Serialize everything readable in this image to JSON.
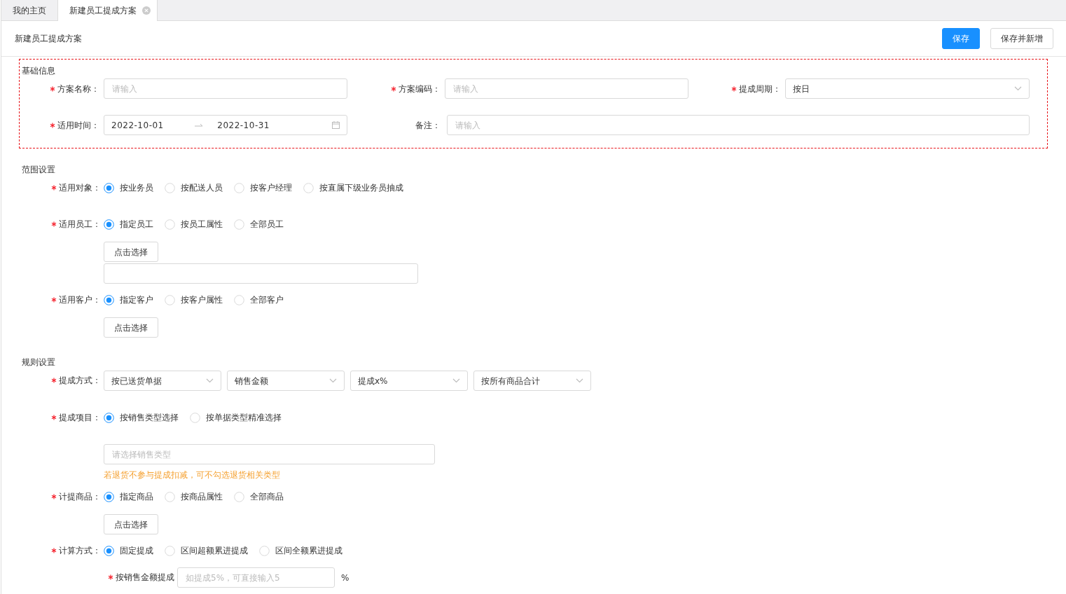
{
  "tabs": [
    {
      "label": "我的主页",
      "selected": false,
      "closable": false
    },
    {
      "label": "新建员工提成方案",
      "selected": true,
      "closable": true
    }
  ],
  "page_title": "新建员工提成方案",
  "buttons": [
    {
      "label": "保存",
      "kind": "primary"
    },
    {
      "label": "保存并新增",
      "kind": "default"
    }
  ],
  "basic_info": {
    "title": "基础信息",
    "highlighted": true,
    "rows": [
      [
        {
          "kind": "input",
          "label": "方案名称：",
          "required": true,
          "placeholder": "请输入"
        },
        {
          "kind": "input",
          "label": "方案编码：",
          "required": true,
          "placeholder": "请输入"
        },
        {
          "kind": "select",
          "label": "提成周期：",
          "required": true,
          "value": "按日"
        }
      ],
      [
        {
          "kind": "daterange",
          "label": "适用时间：",
          "required": true,
          "start": "2022-10-01",
          "end": "2022-10-31"
        },
        {
          "kind": "input",
          "label": "备注：",
          "required": false,
          "placeholder": "请输入"
        }
      ]
    ]
  },
  "sections": [
    {
      "title": "范围设置",
      "items": [
        {
          "label": "适用对象：",
          "required": true,
          "controls": [
            {
              "kind": "radio",
              "options": [
                {
                  "label": "按业务员",
                  "selected": true
                },
                {
                  "label": "按配送人员",
                  "selected": false
                },
                {
                  "label": "按客户经理",
                  "selected": false
                },
                {
                  "label": "按直属下级业务员抽成",
                  "selected": false
                }
              ]
            }
          ]
        },
        {
          "label": "适用员工：",
          "required": true,
          "controls": [
            {
              "kind": "radio",
              "options": [
                {
                  "label": "指定员工",
                  "selected": true
                },
                {
                  "label": "按员工属性",
                  "selected": false
                },
                {
                  "label": "全部员工",
                  "selected": false
                }
              ]
            },
            {
              "kind": "button",
              "label": "点击选择"
            },
            {
              "kind": "box"
            }
          ]
        },
        {
          "label": "适用客户：",
          "required": true,
          "controls": [
            {
              "kind": "radio",
              "options": [
                {
                  "label": "指定客户",
                  "selected": true
                },
                {
                  "label": "按客户属性",
                  "selected": false
                },
                {
                  "label": "全部客户",
                  "selected": false
                }
              ]
            },
            {
              "kind": "button",
              "label": "点击选择"
            }
          ]
        }
      ]
    },
    {
      "title": "规则设置",
      "items": [
        {
          "label": "提成方式：",
          "required": true,
          "controls": [
            {
              "kind": "selects",
              "items": [
                {
                  "value": "按已送货单据"
                },
                {
                  "value": "销售金额"
                },
                {
                  "value": "提成x%"
                },
                {
                  "value": "按所有商品合计"
                }
              ]
            }
          ]
        },
        {
          "label": "提成项目：",
          "required": true,
          "controls": [
            {
              "kind": "radio",
              "options": [
                {
                  "label": "按销售类型选择",
                  "selected": true
                },
                {
                  "label": "按单据类型精准选择",
                  "selected": false
                }
              ]
            },
            {
              "kind": "input",
              "placeholder": "请选择销售类型"
            },
            {
              "kind": "hint",
              "text": "若退货不参与提成扣减，可不勾选退货相关类型"
            }
          ]
        },
        {
          "label": "计提商品：",
          "required": true,
          "controls": [
            {
              "kind": "radio",
              "options": [
                {
                  "label": "指定商品",
                  "selected": true
                },
                {
                  "label": "按商品属性",
                  "selected": false
                },
                {
                  "label": "全部商品",
                  "selected": false
                }
              ]
            },
            {
              "kind": "button",
              "label": "点击选择"
            }
          ]
        },
        {
          "label": "计算方式：",
          "required": true,
          "controls": [
            {
              "kind": "radio",
              "options": [
                {
                  "label": "固定提成",
                  "selected": true
                },
                {
                  "label": "区间超额累进提成",
                  "selected": false
                },
                {
                  "label": "区间全额累进提成",
                  "selected": false
                }
              ]
            }
          ],
          "children": [
            {
              "label": "按销售金额提成",
              "required": true,
              "controls": [
                {
                  "kind": "number",
                  "placeholder": "如提成5%，可直接输入5",
                  "unit": "%"
                }
              ]
            }
          ]
        }
      ]
    }
  ]
}
